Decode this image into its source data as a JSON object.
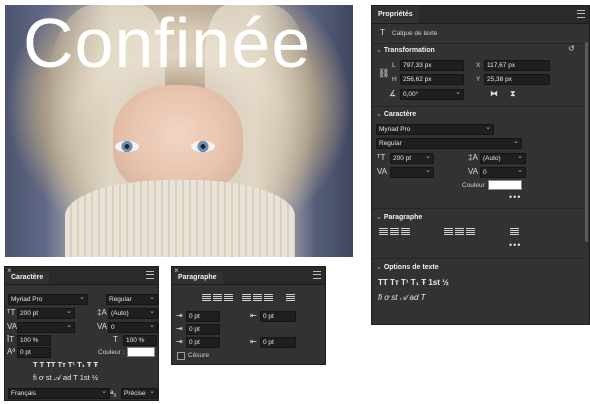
{
  "image": {
    "title": "Confinée"
  },
  "properties": {
    "tab": "Propriétés",
    "layer_type": "Calque de texte",
    "transformation": {
      "title": "Transformation",
      "l_label": "L",
      "l_value": "797,33 px",
      "x_label": "X",
      "x_value": "117,67 px",
      "h_label": "H",
      "h_value": "256,62 px",
      "y_label": "Y",
      "y_value": "25,38 px",
      "angle_value": "0,00°"
    },
    "caractere": {
      "title": "Caractère",
      "font": "Myriad Pro",
      "style": "Regular",
      "size": "200 pt",
      "leading": "(Auto)",
      "tracking": "0",
      "color_label": "Couleur",
      "color": "#ffffff",
      "more": "•••"
    },
    "paragraphe": {
      "title": "Paragraphe",
      "more": "•••"
    },
    "options": {
      "title": "Options de texte",
      "glyphs": "TT Tт T¹ T₁ Ŧ   fi  ơ st 𝒜 ad T 1st ½"
    }
  },
  "caractere_panel": {
    "tab": "Caractère",
    "font": "Myriad Pro",
    "style": "Regular",
    "size": "200 pt",
    "leading": "(Auto)",
    "kerning": "",
    "tracking": "0",
    "vscale": "100 %",
    "hscale": "100 %",
    "baseline": "0 pt",
    "color_label": "Couleur :",
    "glyph_row1": "T  T  TT  Tт  T¹  T₁  Ŧ  Ŧ",
    "glyph_row2": "fi  ơ  st  𝒜  ad  T  1st  ½",
    "language": "Français",
    "aa_label": "a",
    "aa_value": "Précise"
  },
  "paragraphe_panel": {
    "tab": "Paragraphe",
    "indent_left": "0 pt",
    "indent_right": "0 pt",
    "indent_first": "0 pt",
    "space_before": "0 pt",
    "space_after": "0 pt",
    "hyphenate_label": "Césure"
  }
}
